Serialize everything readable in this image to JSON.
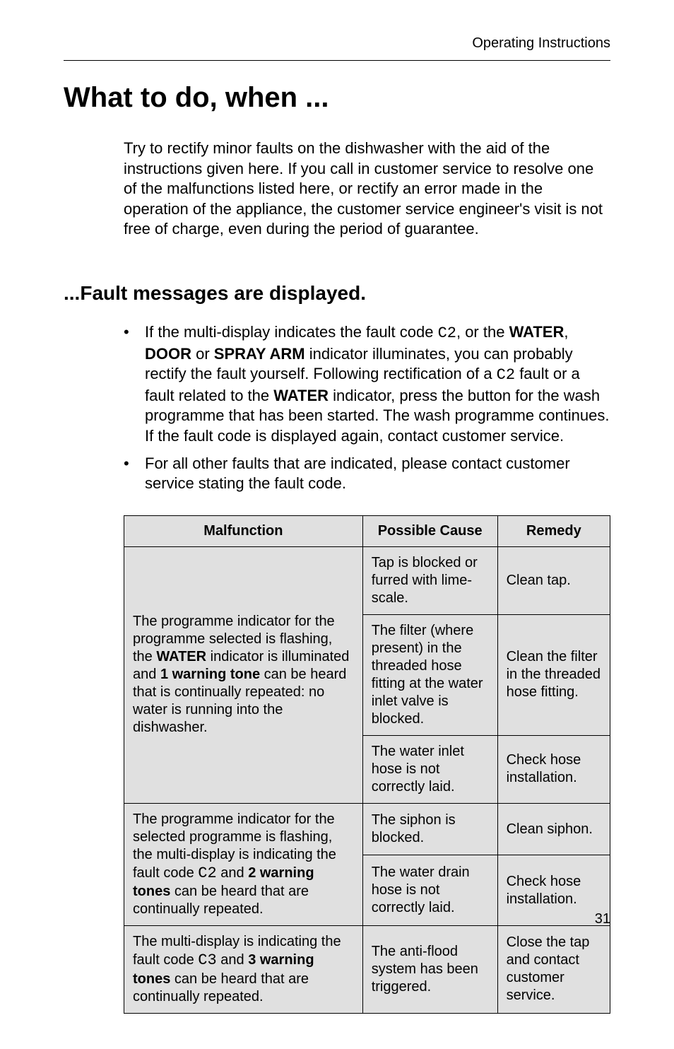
{
  "running_header": "Operating Instructions",
  "title": "What to do, when ...",
  "intro": "Try to rectify minor faults on the dishwasher with the aid of the instructions given here. If you call in customer service to resolve one of the malfunctions listed here, or rectify an error made in the operation of the appliance, the customer service engineer's visit is not free of charge, even during the period of guarantee.",
  "sub_heading": "...Fault messages are displayed.",
  "bullets": {
    "b1": {
      "mark": "•",
      "pre": "If the multi-display indicates the fault code ",
      "code1": "C2",
      "mid1": ", or the ",
      "bold1": "WATER",
      "mid2": ", ",
      "bold2": "DOOR",
      "mid3": " or ",
      "bold3": "SPRAY ARM",
      "mid4": " indicator illuminates, you can  probably rectify the fault yourself. Following rectification of a ",
      "code2": "C2",
      "mid5": " fault or a fault related to the ",
      "bold4": "WATER",
      "post": " indicator, press the button for the wash programme that has been started. The wash programme continues. If the fault code is displayed again, contact customer service."
    },
    "b2": {
      "mark": "•",
      "text": "For all other faults that are indicated, please contact customer service stating the fault code."
    }
  },
  "table": {
    "headers": {
      "c1": "Malfunction",
      "c2": "Possible Cause",
      "c3": "Remedy"
    },
    "rows": {
      "r1": {
        "malfunction": {
          "pre": "The programme indicator for the programme selected is flashing, the ",
          "bold1": "WATER",
          "mid1": " indicator is illuminated and ",
          "bold2": "1 warning tone",
          "post": " can be heard that is continually repeated: no water is running into the dishwasher."
        },
        "cause1": "Tap is blocked or furred with lime-scale.",
        "remedy1": "Clean tap.",
        "cause2": "The filter (where present) in the threaded hose fitting at the water inlet valve is blocked.",
        "remedy2": "Clean the filter in the threaded hose fitting.",
        "cause3": "The water inlet hose is not correctly laid.",
        "remedy3": "Check hose installation."
      },
      "r2": {
        "malfunction": {
          "pre": "The programme indicator for the selected programme is flashing, the multi-display is indicating the fault code ",
          "code": "C2",
          "mid": " and ",
          "bold": "2 warning tones",
          "post": " can be heard that are continually repeated."
        },
        "cause1": "The siphon is blocked.",
        "remedy1": "Clean siphon.",
        "cause2": "The water drain hose is not correctly laid.",
        "remedy2": "Check hose installation."
      },
      "r3": {
        "malfunction": {
          "pre": "The multi-display is indicating the fault code ",
          "code": "C3",
          "mid": " and ",
          "bold": "3 warning tones",
          "post": " can be heard that are continually repeated."
        },
        "cause": "The anti-flood system has been triggered.",
        "remedy": "Close the tap and contact customer service."
      }
    }
  },
  "page_number": "31"
}
